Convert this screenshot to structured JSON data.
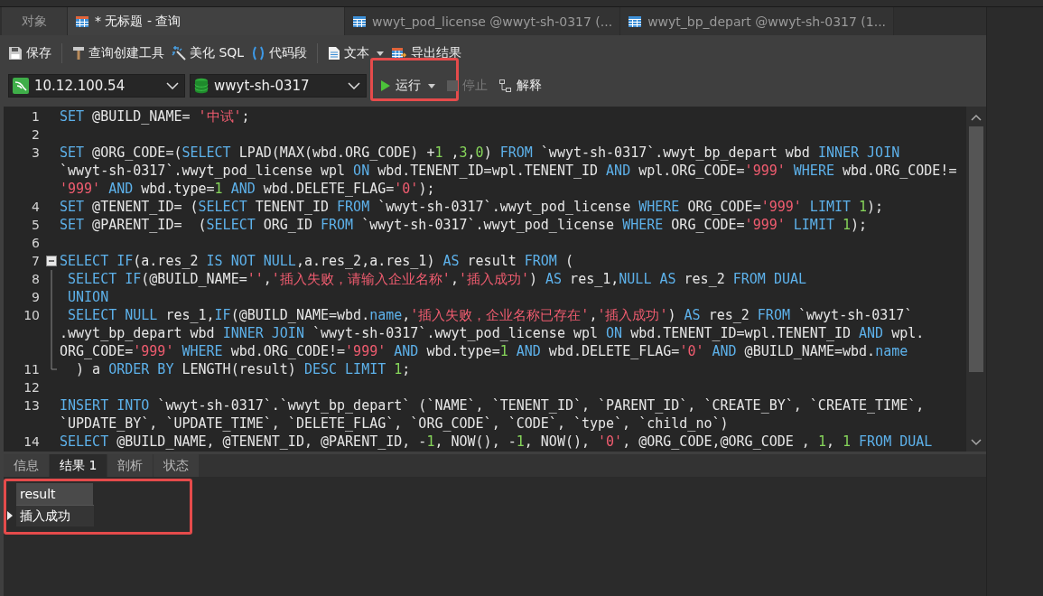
{
  "tabs": [
    {
      "label": "对象",
      "kind": "plain",
      "selected": false
    },
    {
      "label": "* 无标题 - 查询",
      "kind": "query",
      "selected": true
    },
    {
      "label": "wwyt_pod_license @wwyt-sh-0317 (...",
      "kind": "table",
      "selected": false
    },
    {
      "label": "wwyt_bp_depart @wwyt-sh-0317 (1...",
      "kind": "table",
      "selected": false
    }
  ],
  "toolbar": [
    {
      "kind": "save",
      "label": "保存"
    },
    {
      "kind": "separator"
    },
    {
      "kind": "builder",
      "label": "查询创建工具"
    },
    {
      "kind": "beautify",
      "label": "美化 SQL"
    },
    {
      "kind": "snippet",
      "label": "代码段"
    },
    {
      "kind": "separator"
    },
    {
      "kind": "text",
      "label": "文本",
      "dropdown": true
    },
    {
      "kind": "export",
      "label": "导出结果"
    }
  ],
  "connection": {
    "value": "10.12.100.54"
  },
  "database": {
    "value": "wwyt-sh-0317"
  },
  "actions": [
    {
      "kind": "run",
      "label": "运行",
      "dropdown": true,
      "disabled": false,
      "highlighted": true
    },
    {
      "kind": "stop",
      "label": "停止",
      "disabled": true
    },
    {
      "kind": "explain",
      "label": "解释",
      "disabled": false
    }
  ],
  "editor": {
    "lines": [
      {
        "number": "1",
        "segments": [
          {
            "kind": "kw",
            "text": "SET"
          },
          {
            "kind": "plain",
            "text": " @BUILD_NAME= "
          },
          {
            "kind": "str",
            "text": "'中试'"
          },
          {
            "kind": "plain",
            "text": ";"
          }
        ]
      },
      {
        "number": "2"
      },
      {
        "number": "3",
        "segments": [
          {
            "kind": "kw",
            "text": "SET"
          },
          {
            "kind": "plain",
            "text": " @ORG_CODE=("
          },
          {
            "kind": "kw",
            "text": "SELECT"
          },
          {
            "kind": "plain",
            "text": " LPAD(MAX(wbd.ORG_CODE) +"
          },
          {
            "kind": "num",
            "text": "1"
          },
          {
            "kind": "plain",
            "text": " ,"
          },
          {
            "kind": "num",
            "text": "3"
          },
          {
            "kind": "plain",
            "text": ","
          },
          {
            "kind": "num",
            "text": "0"
          },
          {
            "kind": "plain",
            "text": ") "
          },
          {
            "kind": "kw",
            "text": "FROM"
          },
          {
            "kind": "plain",
            "text": " `wwyt-sh-0317`.wwyt_bp_depart wbd "
          },
          {
            "kind": "kw",
            "text": "INNER JOIN"
          }
        ]
      },
      {
        "segments": [
          {
            "kind": "plain",
            "text": "`wwyt-sh-0317`.wwyt_pod_license wpl "
          },
          {
            "kind": "kw",
            "text": "ON"
          },
          {
            "kind": "plain",
            "text": " wbd.TENENT_ID=wpl.TENENT_ID "
          },
          {
            "kind": "kw",
            "text": "AND"
          },
          {
            "kind": "plain",
            "text": " wpl.ORG_CODE="
          },
          {
            "kind": "str",
            "text": "'999'"
          },
          {
            "kind": "kw",
            "text": " WHERE"
          },
          {
            "kind": "plain",
            "text": " wbd.ORG_CODE!="
          }
        ]
      },
      {
        "segments": [
          {
            "kind": "str",
            "text": "'999'"
          },
          {
            "kind": "kw",
            "text": " AND"
          },
          {
            "kind": "plain",
            "text": " wbd.type="
          },
          {
            "kind": "num",
            "text": "1"
          },
          {
            "kind": "kw",
            "text": " AND"
          },
          {
            "kind": "plain",
            "text": " wbd.DELETE_FLAG="
          },
          {
            "kind": "str",
            "text": "'0'"
          },
          {
            "kind": "plain",
            "text": ");"
          }
        ]
      },
      {
        "number": "4",
        "segments": [
          {
            "kind": "kw",
            "text": "SET"
          },
          {
            "kind": "plain",
            "text": " @TENENT_ID= ("
          },
          {
            "kind": "kw",
            "text": "SELECT"
          },
          {
            "kind": "plain",
            "text": " TENENT_ID "
          },
          {
            "kind": "kw",
            "text": "FROM"
          },
          {
            "kind": "plain",
            "text": " `wwyt-sh-0317`.wwyt_pod_license "
          },
          {
            "kind": "kw",
            "text": "WHERE"
          },
          {
            "kind": "plain",
            "text": " ORG_CODE="
          },
          {
            "kind": "str",
            "text": "'999'"
          },
          {
            "kind": "kw",
            "text": " LIMIT"
          },
          {
            "kind": "num",
            "text": " 1"
          },
          {
            "kind": "plain",
            "text": ");"
          }
        ]
      },
      {
        "number": "5",
        "segments": [
          {
            "kind": "kw",
            "text": "SET"
          },
          {
            "kind": "plain",
            "text": " @PARENT_ID=  ("
          },
          {
            "kind": "kw",
            "text": "SELECT"
          },
          {
            "kind": "plain",
            "text": " ORG_ID "
          },
          {
            "kind": "kw",
            "text": "FROM"
          },
          {
            "kind": "plain",
            "text": " `wwyt-sh-0317`.wwyt_pod_license "
          },
          {
            "kind": "kw",
            "text": "WHERE"
          },
          {
            "kind": "plain",
            "text": " ORG_CODE="
          },
          {
            "kind": "str",
            "text": "'999'"
          },
          {
            "kind": "kw",
            "text": " LIMIT"
          },
          {
            "kind": "num",
            "text": " 1"
          },
          {
            "kind": "plain",
            "text": ");"
          }
        ]
      },
      {
        "number": "6"
      },
      {
        "number": "7",
        "fold_start": true,
        "segments": [
          {
            "kind": "kw",
            "text": "SELECT IF"
          },
          {
            "kind": "plain",
            "text": "(a.res_2 "
          },
          {
            "kind": "kw",
            "text": "IS NOT NULL"
          },
          {
            "kind": "plain",
            "text": ",a.res_2,a.res_1) "
          },
          {
            "kind": "kw",
            "text": "AS"
          },
          {
            "kind": "plain",
            "text": " result "
          },
          {
            "kind": "kw",
            "text": "FROM"
          },
          {
            "kind": "plain",
            "text": " ("
          }
        ]
      },
      {
        "number": "8",
        "in_fold": true,
        "segments": [
          {
            "kind": "kw",
            "text": " SELECT IF"
          },
          {
            "kind": "plain",
            "text": "(@BUILD_NAME="
          },
          {
            "kind": "str",
            "text": "''"
          },
          {
            "kind": "plain",
            "text": ","
          },
          {
            "kind": "str",
            "text": "'插入失败，请输入企业名称'"
          },
          {
            "kind": "plain",
            "text": ","
          },
          {
            "kind": "str",
            "text": "'插入成功'"
          },
          {
            "kind": "plain",
            "text": ") "
          },
          {
            "kind": "kw",
            "text": "AS"
          },
          {
            "kind": "plain",
            "text": " res_1,"
          },
          {
            "kind": "kw",
            "text": "NULL AS"
          },
          {
            "kind": "plain",
            "text": " res_2 "
          },
          {
            "kind": "kw",
            "text": "FROM DUAL"
          }
        ]
      },
      {
        "number": "9",
        "in_fold": true,
        "segments": [
          {
            "kind": "kw",
            "text": " UNION"
          }
        ]
      },
      {
        "number": "10",
        "in_fold": true,
        "segments": [
          {
            "kind": "kw",
            "text": " SELECT NULL"
          },
          {
            "kind": "plain",
            "text": " res_1,"
          },
          {
            "kind": "kw",
            "text": "IF"
          },
          {
            "kind": "plain",
            "text": "(@BUILD_NAME=wbd."
          },
          {
            "kind": "kw",
            "text": "name"
          },
          {
            "kind": "plain",
            "text": ","
          },
          {
            "kind": "str",
            "text": "'插入失败，企业名称已存在'"
          },
          {
            "kind": "plain",
            "text": ","
          },
          {
            "kind": "str",
            "text": "'插入成功'"
          },
          {
            "kind": "plain",
            "text": ") "
          },
          {
            "kind": "kw",
            "text": "AS"
          },
          {
            "kind": "plain",
            "text": " res_2 "
          },
          {
            "kind": "kw",
            "text": "FROM"
          },
          {
            "kind": "plain",
            "text": " `wwyt-sh-0317`"
          }
        ]
      },
      {
        "in_fold": true,
        "segments": [
          {
            "kind": "plain",
            "text": ".wwyt_bp_depart wbd "
          },
          {
            "kind": "kw",
            "text": "INNER JOIN"
          },
          {
            "kind": "plain",
            "text": " `wwyt-sh-0317`.wwyt_pod_license wpl "
          },
          {
            "kind": "kw",
            "text": "ON"
          },
          {
            "kind": "plain",
            "text": " wbd.TENENT_ID=wpl.TENENT_ID "
          },
          {
            "kind": "kw",
            "text": "AND"
          },
          {
            "kind": "plain",
            "text": " wpl."
          }
        ]
      },
      {
        "in_fold": true,
        "segments": [
          {
            "kind": "plain",
            "text": "ORG_CODE="
          },
          {
            "kind": "str",
            "text": "'999'"
          },
          {
            "kind": "kw",
            "text": " WHERE"
          },
          {
            "kind": "plain",
            "text": " wbd.ORG_CODE!="
          },
          {
            "kind": "str",
            "text": "'999'"
          },
          {
            "kind": "kw",
            "text": " AND"
          },
          {
            "kind": "plain",
            "text": " wbd.type="
          },
          {
            "kind": "num",
            "text": "1"
          },
          {
            "kind": "kw",
            "text": " AND"
          },
          {
            "kind": "plain",
            "text": " wbd.DELETE_FLAG="
          },
          {
            "kind": "str",
            "text": "'0'"
          },
          {
            "kind": "kw",
            "text": " AND"
          },
          {
            "kind": "plain",
            "text": " @BUILD_NAME=wbd."
          },
          {
            "kind": "kw",
            "text": "name"
          }
        ]
      },
      {
        "number": "11",
        "fold_end": true,
        "segments": [
          {
            "kind": "plain",
            "text": "  ) a "
          },
          {
            "kind": "kw",
            "text": "ORDER BY"
          },
          {
            "kind": "plain",
            "text": " LENGTH(result) "
          },
          {
            "kind": "kw",
            "text": "DESC LIMIT"
          },
          {
            "kind": "num",
            "text": " 1"
          },
          {
            "kind": "plain",
            "text": ";"
          }
        ]
      },
      {
        "number": "12"
      },
      {
        "number": "13",
        "segments": [
          {
            "kind": "kw",
            "text": "INSERT INTO"
          },
          {
            "kind": "plain",
            "text": " `wwyt-sh-0317`.`wwyt_bp_depart` (`NAME`, `TENENT_ID`, `PARENT_ID`, `CREATE_BY`, `CREATE_TIME`,"
          }
        ]
      },
      {
        "segments": [
          {
            "kind": "plain",
            "text": "`UPDATE_BY`, `UPDATE_TIME`, `DELETE_FLAG`, `ORG_CODE`, `CODE`, `type`, `child_no`)"
          }
        ]
      },
      {
        "number": "14",
        "segments": [
          {
            "kind": "kw",
            "text": "SELECT"
          },
          {
            "kind": "plain",
            "text": " @BUILD_NAME, @TENENT_ID, @PARENT_ID, -"
          },
          {
            "kind": "num",
            "text": "1"
          },
          {
            "kind": "plain",
            "text": ", NOW(), -"
          },
          {
            "kind": "num",
            "text": "1"
          },
          {
            "kind": "plain",
            "text": ", NOW(), "
          },
          {
            "kind": "str",
            "text": "'0'"
          },
          {
            "kind": "plain",
            "text": ", @ORG_CODE,@ORG_CODE , "
          },
          {
            "kind": "num",
            "text": "1"
          },
          {
            "kind": "plain",
            "text": ", "
          },
          {
            "kind": "num",
            "text": "1"
          },
          {
            "kind": "kw",
            "text": " FROM DUAL"
          }
        ]
      }
    ]
  },
  "result_tabs": [
    {
      "label": "信息",
      "selected": false
    },
    {
      "label": "结果 1",
      "selected": true
    },
    {
      "label": "剖析",
      "selected": false
    },
    {
      "label": "状态",
      "selected": false
    }
  ],
  "result_grid": {
    "highlighted": true,
    "columns": [
      "result"
    ],
    "rows": [
      {
        "cells": [
          "插入成功"
        ],
        "current": true
      }
    ]
  }
}
